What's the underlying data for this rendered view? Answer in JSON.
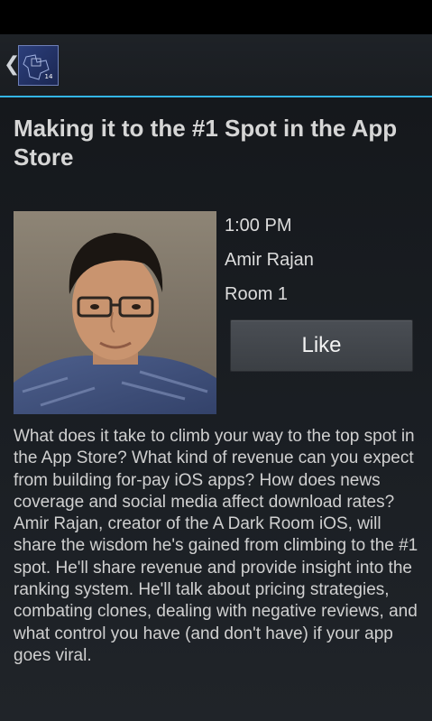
{
  "action_bar": {
    "up_icon": "chevron-left-icon",
    "logo_text": "14",
    "accent_color": "#33b5e5"
  },
  "session": {
    "title": "Making it to the #1 Spot in the App Store",
    "time": "1:00 PM",
    "speaker": "Amir Rajan",
    "room": "Room 1",
    "like_label": "Like",
    "description": "What does it take to climb your way to the top spot in the App Store? What kind of revenue can you expect from building for-pay iOS apps? How does news coverage and social media affect download rates? Amir Rajan, creator of the A Dark Room iOS, will share the wisdom he's gained from climbing to the #1 spot. He'll share revenue and provide insight into the ranking system. He'll talk about pricing strategies, combating clones, dealing with negative reviews, and what control you have (and don't have) if your app goes viral."
  }
}
